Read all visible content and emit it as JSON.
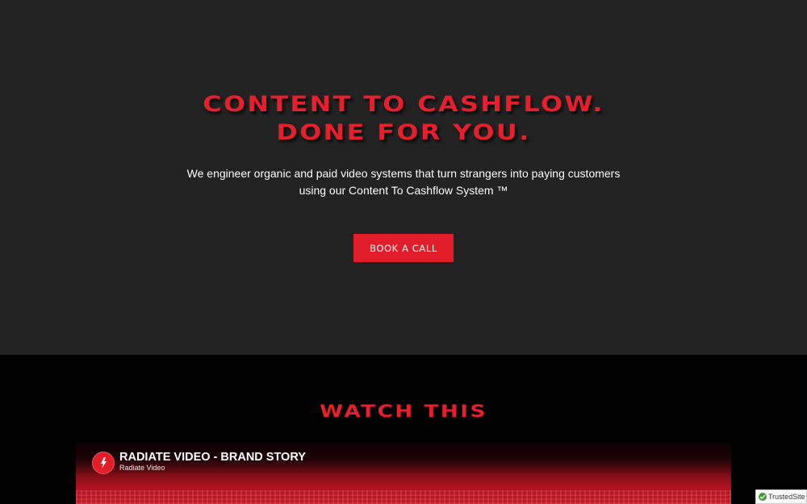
{
  "hero": {
    "title_line1": "CONTENT TO CASHFLOW.",
    "title_line2": "DONE FOR YOU.",
    "subtitle_line1": "We engineer organic and paid video systems that turn strangers into paying customers",
    "subtitle_line2": "using our Content To Cashflow System ™",
    "cta_label": "BOOK A CALL"
  },
  "watch": {
    "heading": "WATCH THIS"
  },
  "video": {
    "title": "RADIATE VIDEO - BRAND STORY",
    "channel": "Radiate Video",
    "channel_logo_icon": "radiate-video-logo-icon"
  },
  "badge": {
    "label": "TrustedSite",
    "icon": "checkmark-icon"
  },
  "colors": {
    "accent": "#e51f2c",
    "hero_background": "#222222",
    "page_background": "#000000"
  }
}
